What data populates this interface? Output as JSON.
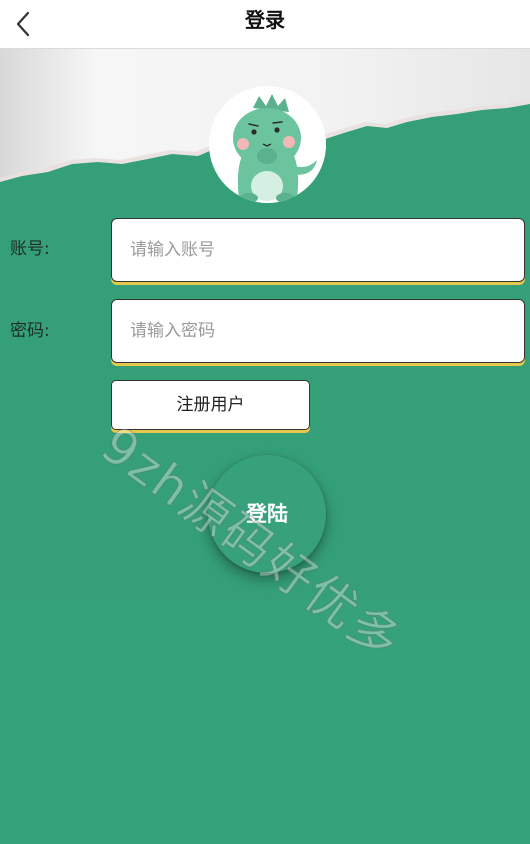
{
  "header": {
    "title": "登录"
  },
  "form": {
    "account": {
      "label": "账号:",
      "placeholder": "请输入账号",
      "value": ""
    },
    "password": {
      "label": "密码:",
      "placeholder": "请输入密码",
      "value": ""
    },
    "register_label": "注册用户",
    "login_label": "登陆"
  },
  "watermark": "9zh源码好优多",
  "colors": {
    "background_green": "#35a078",
    "input_accent": "#e6c94a",
    "mascot_green": "#6cc49e"
  },
  "icons": {
    "back": "chevron-left-icon",
    "avatar": "dinosaur-mascot"
  }
}
